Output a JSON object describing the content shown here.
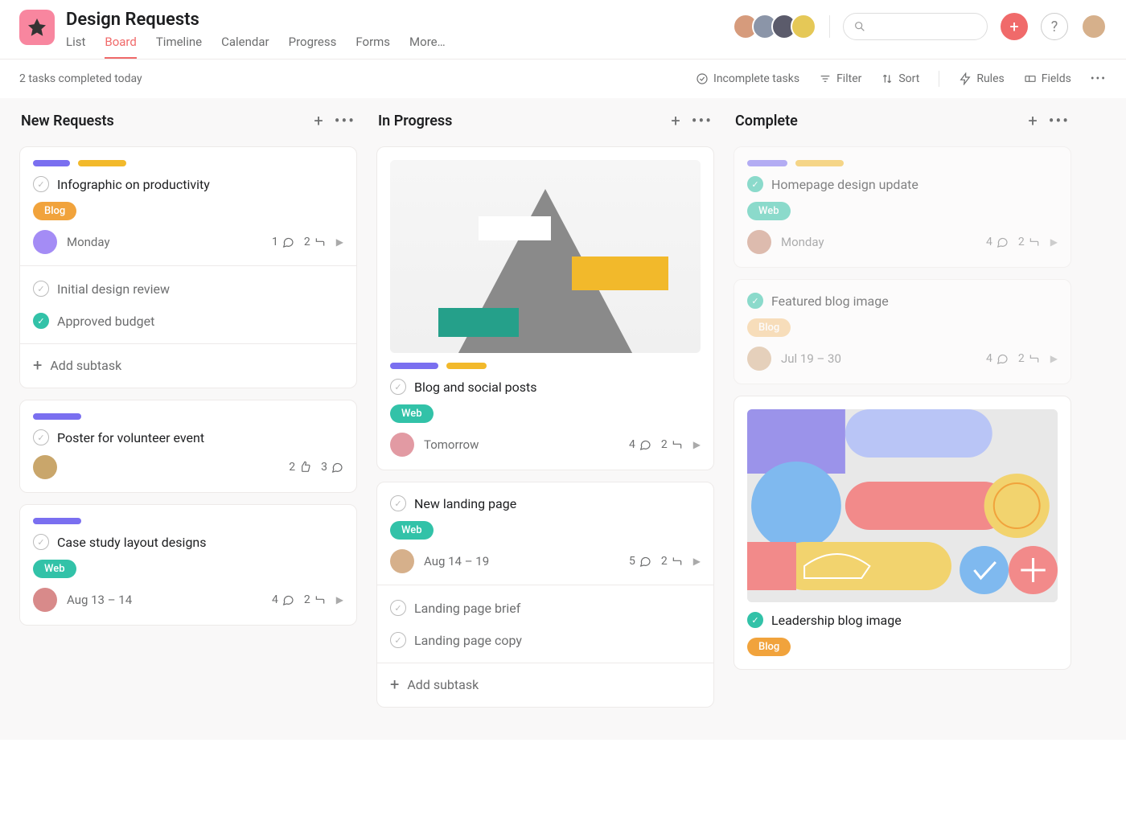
{
  "project": {
    "title": "Design Requests"
  },
  "tabs": {
    "list": "List",
    "board": "Board",
    "timeline": "Timeline",
    "calendar": "Calendar",
    "progress": "Progress",
    "forms": "Forms",
    "more": "More…"
  },
  "toolbar": {
    "status": "2 tasks completed today",
    "incomplete": "Incomplete tasks",
    "filter": "Filter",
    "sort": "Sort",
    "rules": "Rules",
    "fields": "Fields"
  },
  "colors": {
    "purple": "#7a6ff0",
    "yellow": "#f2b92b",
    "orange": "#f1a33c",
    "teal": "#32c2a8",
    "pink": "#f06a6a"
  },
  "columns": [
    {
      "title": "New Requests",
      "cards": [
        {
          "pills": [
            "purple",
            "yellow"
          ],
          "title": "Infographic on productivity",
          "tag": {
            "label": "Blog",
            "color": "orange"
          },
          "avatar": {
            "bg": "#a48cf5"
          },
          "dateText": "Monday",
          "comments": 1,
          "subtasks": 2,
          "subRows": [
            {
              "done": false,
              "label": "Initial design review"
            },
            {
              "done": true,
              "label": "Approved budget"
            }
          ],
          "addSubtask": "Add subtask"
        },
        {
          "pills": [
            "purple"
          ],
          "title": "Poster for volunteer event",
          "avatar": {
            "bg": "#c9a66b"
          },
          "likes": 2,
          "comments": 3
        },
        {
          "pills": [
            "purple"
          ],
          "title": "Case study layout designs",
          "tag": {
            "label": "Web",
            "color": "teal"
          },
          "avatar": {
            "bg": "#d88a8a"
          },
          "dateText": "Aug 13 – 14",
          "comments": 4,
          "subtasks": 2
        }
      ]
    },
    {
      "title": "In Progress",
      "cards": [
        {
          "cover": "mountain",
          "pills": [
            "purple",
            "yellow"
          ],
          "title": "Blog and social posts",
          "tag": {
            "label": "Web",
            "color": "teal"
          },
          "avatar": {
            "bg": "#e29aa3"
          },
          "dateText": "Tomorrow",
          "comments": 4,
          "subtasks": 2
        },
        {
          "title": "New landing page",
          "tag": {
            "label": "Web",
            "color": "teal"
          },
          "avatar": {
            "bg": "#d6b08b"
          },
          "dateText": "Aug 14 – 19",
          "comments": 5,
          "subtasks": 2,
          "subRows": [
            {
              "done": false,
              "label": "Landing page brief"
            },
            {
              "done": false,
              "label": "Landing page copy"
            }
          ],
          "addSubtask": "Add subtask"
        }
      ]
    },
    {
      "title": "Complete",
      "cards": [
        {
          "faded": true,
          "pills": [
            "purple",
            "yellow"
          ],
          "done": true,
          "title": "Homepage design update",
          "tag": {
            "label": "Web",
            "color": "teal"
          },
          "avatar": {
            "bg": "#c78a72"
          },
          "dateText": "Monday",
          "comments": 4,
          "subtasks": 2
        },
        {
          "faded": true,
          "done": true,
          "title": "Featured blog image",
          "tag": {
            "label": "Blog",
            "color": "orange",
            "faded": true
          },
          "avatar": {
            "bg": "#d6b08b"
          },
          "dateText": "Jul 19 – 30",
          "comments": 4,
          "subtasks": 2
        },
        {
          "cover": "abstract",
          "done": true,
          "title": "Leadership blog image",
          "tag": {
            "label": "Blog",
            "color": "orange"
          }
        }
      ]
    }
  ],
  "avatars": {
    "team": [
      {
        "bg": "#d69b7c"
      },
      {
        "bg": "#8b95a8"
      },
      {
        "bg": "#5b5b6b"
      },
      {
        "bg": "#e5c857"
      }
    ],
    "me": {
      "bg": "#d6b08b"
    }
  }
}
